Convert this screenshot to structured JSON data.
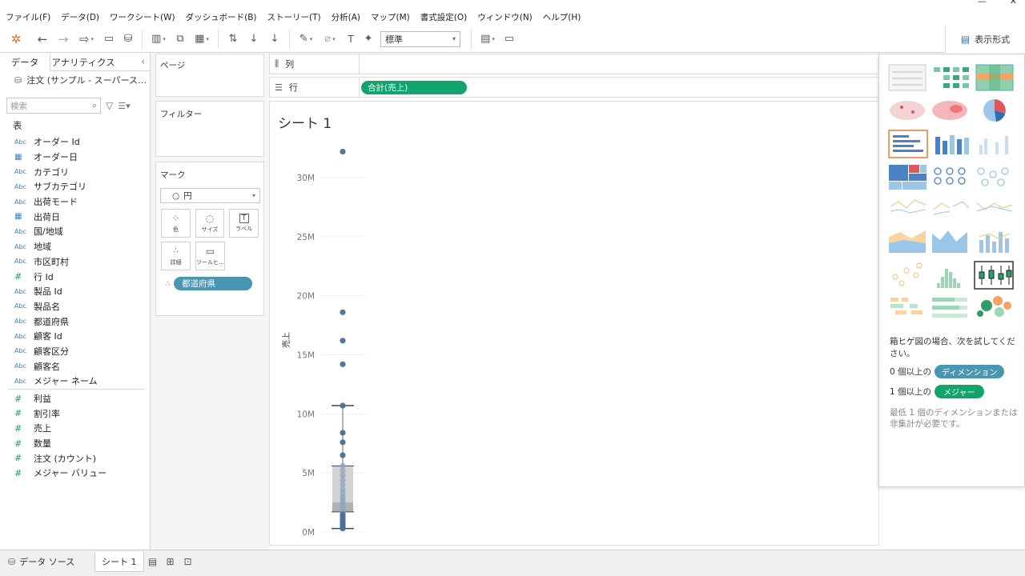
{
  "window": {
    "title": ""
  },
  "menu": [
    "ファイル(F)",
    "データ(D)",
    "ワークシート(W)",
    "ダッシュボード(B)",
    "ストーリー(T)",
    "分析(A)",
    "マップ(M)",
    "書式設定(O)",
    "ウィンドウ(N)",
    "ヘルプ(H)"
  ],
  "toolbar": {
    "fit_value": "標準",
    "show_me_label": "表示形式"
  },
  "left": {
    "tab_data": "データ",
    "tab_analytics": "アナリティクス",
    "datasource": "注文 (サンプル - スーパース…",
    "search_placeholder": "検索",
    "table_header": "表",
    "dimensions": [
      {
        "type": "Abc",
        "name": "オーダー Id"
      },
      {
        "type": "date",
        "name": "オーダー日"
      },
      {
        "type": "Abc",
        "name": "カテゴリ"
      },
      {
        "type": "Abc",
        "name": "サブカテゴリ"
      },
      {
        "type": "Abc",
        "name": "出荷モード"
      },
      {
        "type": "date",
        "name": "出荷日"
      },
      {
        "type": "Abc",
        "name": "国/地域"
      },
      {
        "type": "Abc",
        "name": "地域"
      },
      {
        "type": "Abc",
        "name": "市区町村"
      },
      {
        "type": "#",
        "name": "行 Id"
      },
      {
        "type": "Abc",
        "name": "製品 Id"
      },
      {
        "type": "Abc",
        "name": "製品名"
      },
      {
        "type": "Abc",
        "name": "都道府県"
      },
      {
        "type": "Abc",
        "name": "顧客 Id"
      },
      {
        "type": "Abc",
        "name": "顧客区分"
      },
      {
        "type": "Abc",
        "name": "顧客名"
      },
      {
        "type": "Abc",
        "name": "メジャー ネーム"
      }
    ],
    "measures": [
      {
        "type": "#",
        "name": "利益"
      },
      {
        "type": "#",
        "name": "割引率"
      },
      {
        "type": "#",
        "name": "売上"
      },
      {
        "type": "#",
        "name": "数量"
      },
      {
        "type": "#",
        "name": "注文 (カウント)"
      },
      {
        "type": "#",
        "name": "メジャー バリュー"
      }
    ]
  },
  "cards": {
    "pages": "ページ",
    "filters": "フィルター",
    "marks": "マーク",
    "mark_type": "円",
    "buttons": [
      {
        "icon": "color-icon",
        "label": "色"
      },
      {
        "icon": "size-icon",
        "label": "サイズ"
      },
      {
        "icon": "label-icon",
        "label": "ラベル"
      },
      {
        "icon": "detail-icon",
        "label": "詳細"
      },
      {
        "icon": "tooltip-icon",
        "label": "ツールヒ…"
      }
    ],
    "detail_pill": "都道府県"
  },
  "shelves": {
    "columns_label": "列",
    "rows_label": "行",
    "rows_pill": "合計(売上)"
  },
  "sheet": {
    "title": "シート 1"
  },
  "chart_data": {
    "type": "scatter",
    "subtype": "box-plot",
    "ylabel": "売上",
    "ylim": [
      0,
      34000000
    ],
    "yticks": [
      0,
      5000000,
      10000000,
      15000000,
      20000000,
      25000000,
      30000000
    ],
    "ytick_labels": [
      "0M",
      "5M",
      "10M",
      "15M",
      "20M",
      "25M",
      "30M"
    ],
    "box": {
      "whisker_low": 300000,
      "q1": 1700000,
      "median": 2500000,
      "q3": 5600000,
      "whisker_high": 10700000
    },
    "values": [
      32200000,
      18600000,
      16200000,
      14200000,
      10700000,
      8400000,
      7600000,
      6500000,
      5600000,
      5200000,
      4800000,
      4400000,
      4000000,
      3600000,
      3300000,
      3000000,
      2800000,
      2600000,
      2400000,
      2300000,
      2100000,
      1900000,
      1700000,
      1500000,
      1300000,
      1100000,
      900000,
      700000,
      550000,
      400000,
      300000
    ]
  },
  "show_me": {
    "hint": "箱ヒゲ図の場合、次を試してください。",
    "req1_prefix": "0 個以上の",
    "req1_tag": "ディメンション",
    "req2_prefix": "1 個以上の",
    "req2_tag": "メジャー",
    "note": "最低 1 個のディメンションまたは非集計が必要です。"
  },
  "bottom": {
    "datasource_tab": "データ ソース",
    "sheet_tab": "シート 1"
  }
}
